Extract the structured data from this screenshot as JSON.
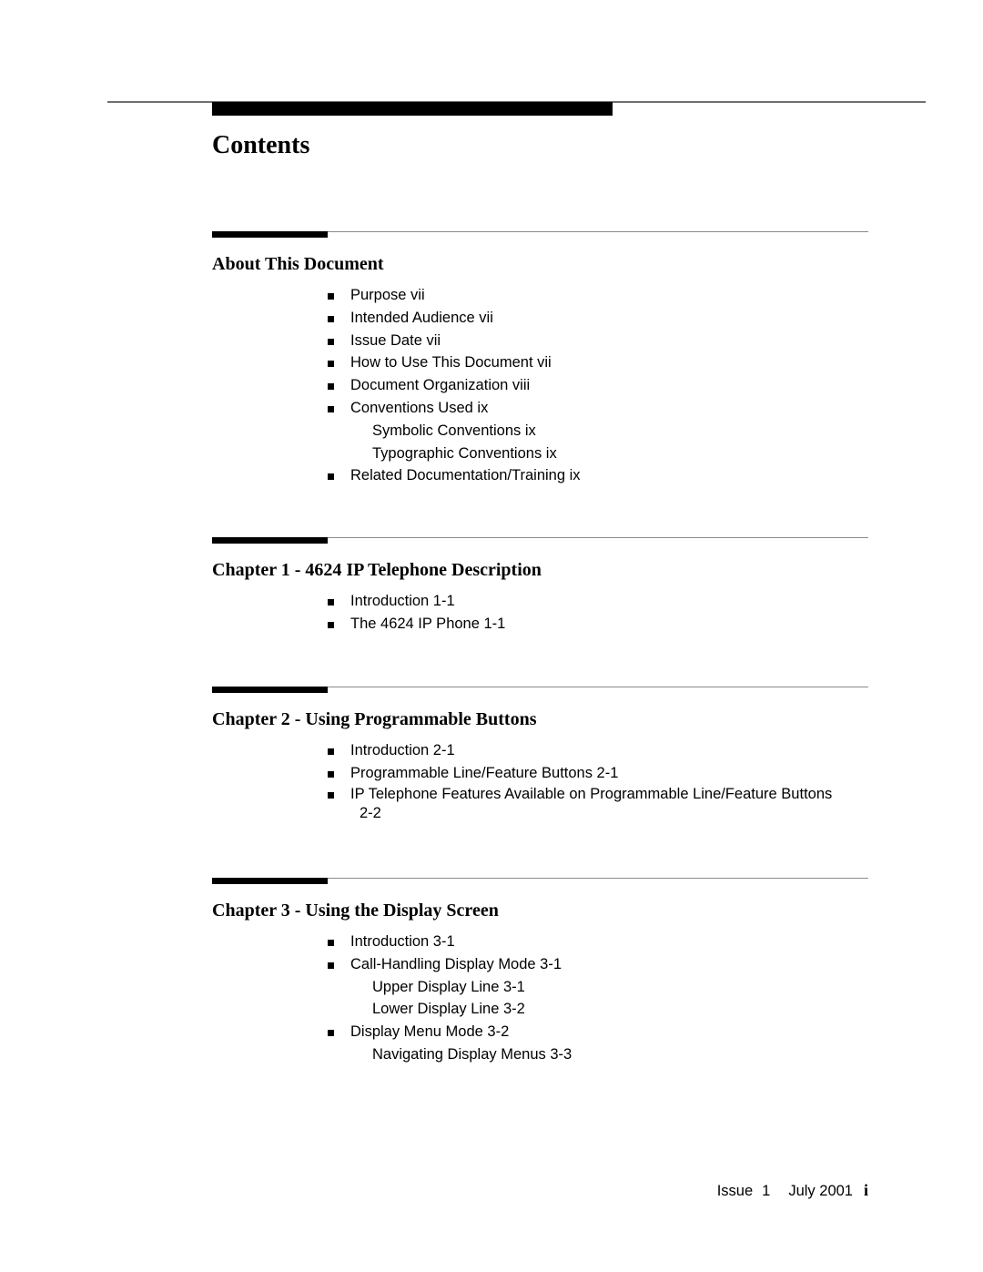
{
  "page": {
    "title": "Contents"
  },
  "sections": [
    {
      "title": "About This Document",
      "entries": [
        {
          "label": "Purpose vii",
          "level": 1
        },
        {
          "label": "Intended Audience vii",
          "level": 1
        },
        {
          "label": "Issue Date vii",
          "level": 1
        },
        {
          "label": "How to Use This Document vii",
          "level": 1
        },
        {
          "label": "Document Organization viii",
          "level": 1
        },
        {
          "label": "Conventions Used ix",
          "level": 1
        },
        {
          "label": "Symbolic Conventions ix",
          "level": 2
        },
        {
          "label": "Typographic Conventions ix",
          "level": 2
        },
        {
          "label": "Related Documentation/Training ix",
          "level": 1
        }
      ]
    },
    {
      "title": "Chapter 1 - 4624 IP Telephone Description",
      "entries": [
        {
          "label": "Introduction 1-1",
          "level": 1
        },
        {
          "label": "The 4624 IP Phone 1-1",
          "level": 1
        }
      ]
    },
    {
      "title": "Chapter 2 - Using Programmable Buttons",
      "entries": [
        {
          "label": "Introduction 2-1",
          "level": 1
        },
        {
          "label": "Programmable Line/Feature Buttons 2-1",
          "level": 1
        },
        {
          "label": "IP Telephone Features Available on Programmable Line/Feature Buttons",
          "continuation": "2-2",
          "level": 1
        }
      ]
    },
    {
      "title": "Chapter 3 - Using the Display Screen",
      "entries": [
        {
          "label": "Introduction 3-1",
          "level": 1
        },
        {
          "label": "Call-Handling Display Mode 3-1",
          "level": 1
        },
        {
          "label": "Upper Display Line 3-1",
          "level": 2
        },
        {
          "label": "Lower Display Line 3-2",
          "level": 2
        },
        {
          "label": "Display Menu Mode 3-2",
          "level": 1
        },
        {
          "label": "Navigating Display Menus 3-3",
          "level": 2
        }
      ]
    }
  ],
  "footer": {
    "issue_label": "Issue",
    "issue_number": "1",
    "date": "July 2001",
    "page_number": "i"
  }
}
